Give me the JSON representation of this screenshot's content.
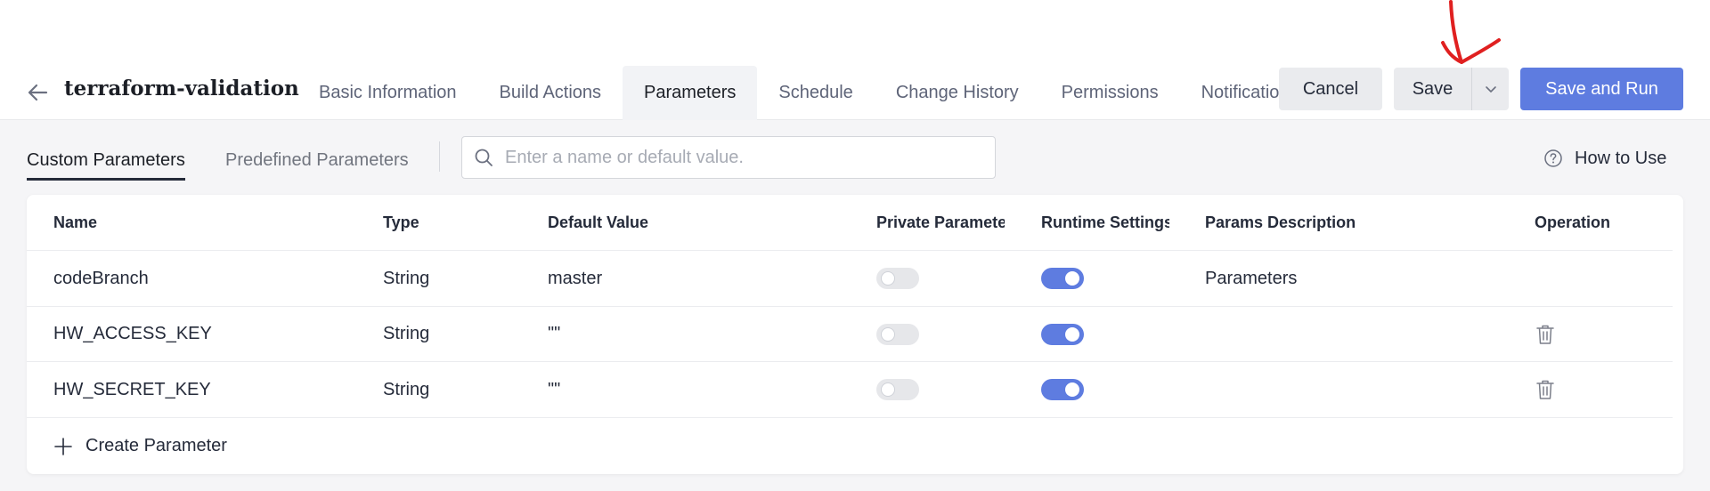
{
  "header": {
    "title": "terraform-validation",
    "tabs": [
      {
        "label": "Basic Information"
      },
      {
        "label": "Build Actions"
      },
      {
        "label": "Parameters"
      },
      {
        "label": "Schedule"
      },
      {
        "label": "Change History"
      },
      {
        "label": "Permissions"
      },
      {
        "label": "Notifications"
      }
    ],
    "active_tab": "Parameters",
    "cancel_label": "Cancel",
    "save_label": "Save",
    "save_run_label": "Save and Run"
  },
  "subtabs": {
    "custom": "Custom Parameters",
    "predefined": "Predefined Parameters",
    "active": "Custom Parameters"
  },
  "search": {
    "placeholder": "Enter a name or default value.",
    "value": ""
  },
  "help": {
    "label": "How to Use"
  },
  "table": {
    "headers": {
      "name": "Name",
      "type": "Type",
      "default": "Default Value",
      "private": "Private Parameter",
      "runtime": "Runtime Settings",
      "description": "Params Description",
      "operation": "Operation"
    },
    "rows": [
      {
        "name": "codeBranch",
        "type": "String",
        "default": "master",
        "private": false,
        "runtime": true,
        "description": "Parameters",
        "deletable": false
      },
      {
        "name": "HW_ACCESS_KEY",
        "type": "String",
        "default": "\"\"",
        "private": false,
        "runtime": true,
        "description": "",
        "deletable": true
      },
      {
        "name": "HW_SECRET_KEY",
        "type": "String",
        "default": "\"\"",
        "private": false,
        "runtime": true,
        "description": "",
        "deletable": true
      }
    ]
  },
  "create_label": "Create Parameter",
  "icons": {
    "back": "arrow-left-icon",
    "dropdown": "chevron-down-icon",
    "search": "search-icon",
    "help": "question-circle-icon",
    "delete": "trash-icon",
    "add": "plus-icon"
  },
  "colors": {
    "primary": "#5e7ce0",
    "annotation": "#e02020"
  }
}
